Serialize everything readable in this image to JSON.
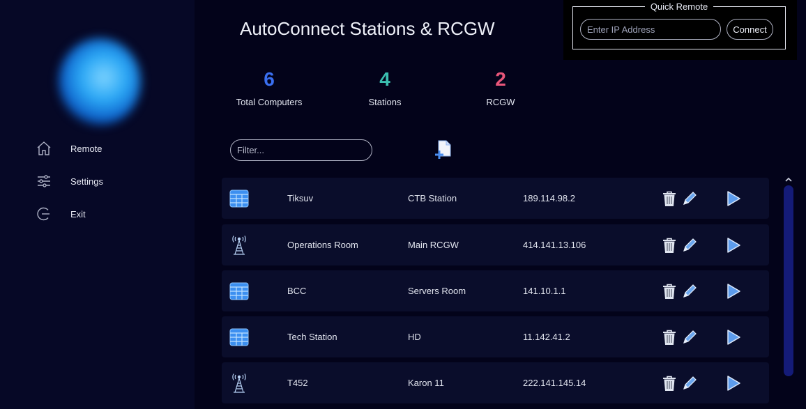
{
  "sidebar": {
    "items": [
      {
        "label": "Remote",
        "icon": "home-icon"
      },
      {
        "label": "Settings",
        "icon": "sliders-icon"
      },
      {
        "label": "Exit",
        "icon": "exit-icon"
      }
    ]
  },
  "page_title": "AutoConnect Stations & RCGW",
  "stats": [
    {
      "value": "6",
      "label": "Total Computers",
      "color": "#3a6ff0"
    },
    {
      "value": "4",
      "label": "Stations",
      "color": "#3bbfb0"
    },
    {
      "value": "2",
      "label": "RCGW",
      "color": "#e8567a"
    }
  ],
  "quick_remote": {
    "title": "Quick Remote",
    "ip_placeholder": "Enter IP Address",
    "connect_label": "Connect"
  },
  "filter": {
    "placeholder": "Filter..."
  },
  "rows": [
    {
      "type": "station",
      "name": "Tiksuv",
      "location": "CTB Station",
      "ip": "189.114.98.2"
    },
    {
      "type": "rcgw",
      "name": "Operations Room",
      "location": "Main RCGW",
      "ip": "414.141.13.106"
    },
    {
      "type": "station",
      "name": "BCC",
      "location": "Servers Room",
      "ip": "141.10.1.1"
    },
    {
      "type": "station",
      "name": "Tech Station",
      "location": "HD",
      "ip": "11.142.41.2"
    },
    {
      "type": "rcgw",
      "name": "T452",
      "location": "Karon 11",
      "ip": "222.141.145.14"
    }
  ],
  "colors": {
    "accent_blue": "#4a9cf0",
    "background": "#03031a",
    "sidebar": "#060826",
    "row": "#0a0d2b",
    "scrollbar": "#141b78"
  }
}
